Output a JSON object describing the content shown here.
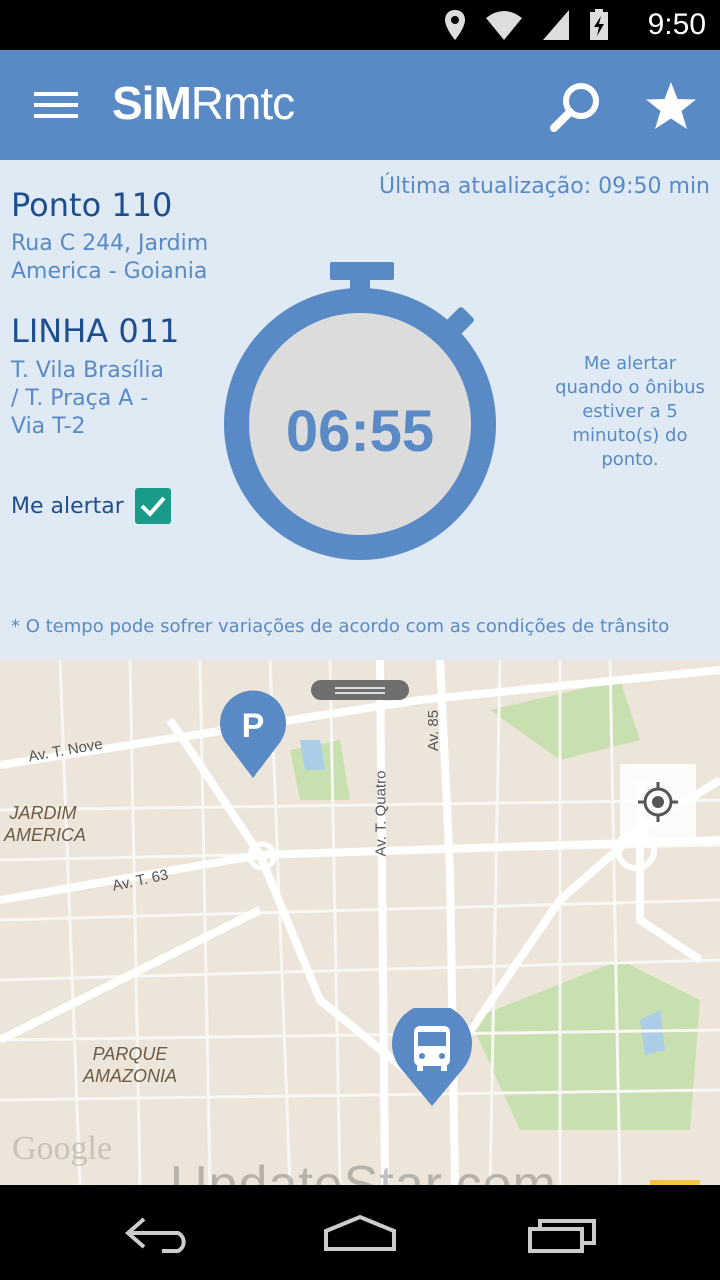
{
  "status_bar": {
    "time": "9:50"
  },
  "app_bar": {
    "logo_bold": "SiM",
    "logo_light": "Rmtc"
  },
  "stop": {
    "title": "Ponto 110",
    "address": "Rua C 244, Jardim America - Goiania"
  },
  "update": {
    "text": "Última atualização: 09:50 min"
  },
  "line": {
    "title": "LINHA 011",
    "route": "T. Vila Brasília / T. Praça A - Via T-2"
  },
  "alert": {
    "label": "Me alertar",
    "checked": true,
    "info": "Me alertar quando o ônibus estiver a 5 minuto(s) do ponto."
  },
  "timer": {
    "value": "06:55"
  },
  "disclaimer": "* O tempo pode sofrer variações de acordo com as condições de trânsito",
  "map": {
    "streets": {
      "t_nove": "Av. T. Nove",
      "t_63": "Av. T. 63",
      "t_quatro": "Av. T. Quatro",
      "t_85": "Av. 85"
    },
    "areas": {
      "jardim_america": "JARDIM AMERICA",
      "parque_amazonia": "PARQUE AMAZONIA"
    },
    "attribution": "Google",
    "parking_marker": "P",
    "watermark": "UpdateStar.com"
  },
  "colors": {
    "primary": "#5a8ac6",
    "panel": "#dfeaf4",
    "dark_text": "#1f4e8e",
    "check": "#1a9b8a"
  }
}
